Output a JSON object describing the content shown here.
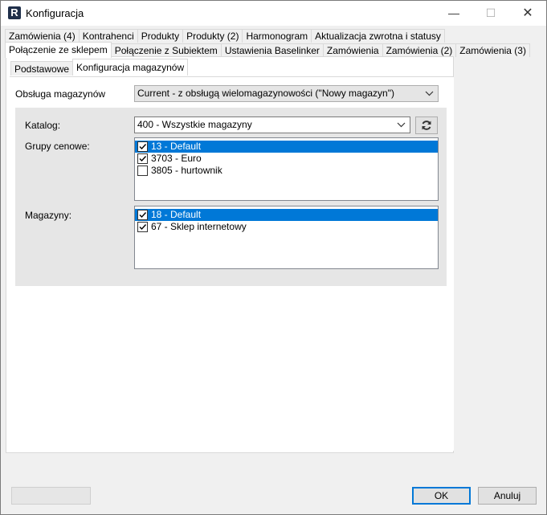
{
  "window": {
    "title": "Konfiguracja",
    "icon_letter": "R",
    "minimize": "—",
    "maximize": "☐",
    "close": "✕"
  },
  "tabs_row1": [
    "Zamówienia (4)",
    "Kontrahenci",
    "Produkty",
    "Produkty (2)",
    "Harmonogram",
    "Aktualizacja zwrotna i statusy"
  ],
  "tabs_row2": [
    "Połączenie ze sklepem",
    "Połączenie z Subiektem",
    "Ustawienia Baselinker",
    "Zamówienia",
    "Zamówienia (2)",
    "Zamówienia (3)"
  ],
  "subtabs": [
    "Podstawowe",
    "Konfiguracja magazynów"
  ],
  "form": {
    "obsluga_label": "Obsługa magazynów",
    "obsluga_value": "Current - z obsługą wielomagazynowości (\"Nowy magazyn\")",
    "katalog_label": "Katalog:",
    "katalog_value": "400 - Wszystkie magazyny",
    "grupy_label": "Grupy cenowe:",
    "grupy_items": [
      {
        "label": "13 - Default",
        "checked": true,
        "selected": true
      },
      {
        "label": "3703 - Euro",
        "checked": true,
        "selected": false
      },
      {
        "label": "3805 - hurtownik",
        "checked": false,
        "selected": false
      }
    ],
    "magazyny_label": "Magazyny:",
    "magazyny_items": [
      {
        "label": "18 - Default",
        "checked": true,
        "selected": true
      },
      {
        "label": "67 - Sklep internetowy",
        "checked": true,
        "selected": false
      }
    ]
  },
  "buttons": {
    "disabled_label": "",
    "ok": "OK",
    "cancel": "Anuluj"
  }
}
